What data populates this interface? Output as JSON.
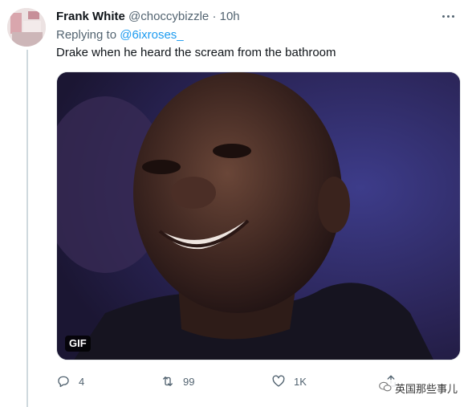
{
  "tweet": {
    "author_name": "Frank White",
    "author_handle": "@choccybizzle",
    "separator": "·",
    "time": "10h",
    "replying_to_label": "Replying to",
    "replying_to_handle": "@6ixroses_",
    "text": "Drake when he heard the scream from the bathroom",
    "media_badge": "GIF"
  },
  "actions": {
    "replies": "4",
    "retweets": "99",
    "likes": "1K"
  },
  "watermark": {
    "text": "英国那些事儿"
  },
  "colors": {
    "text_primary": "#0f1419",
    "text_secondary": "#536471",
    "link": "#1d9bf0",
    "thread_line": "#cfd9de"
  },
  "icons": [
    "more-icon",
    "reply-icon",
    "retweet-icon",
    "like-icon",
    "share-icon",
    "wechat-icon"
  ]
}
